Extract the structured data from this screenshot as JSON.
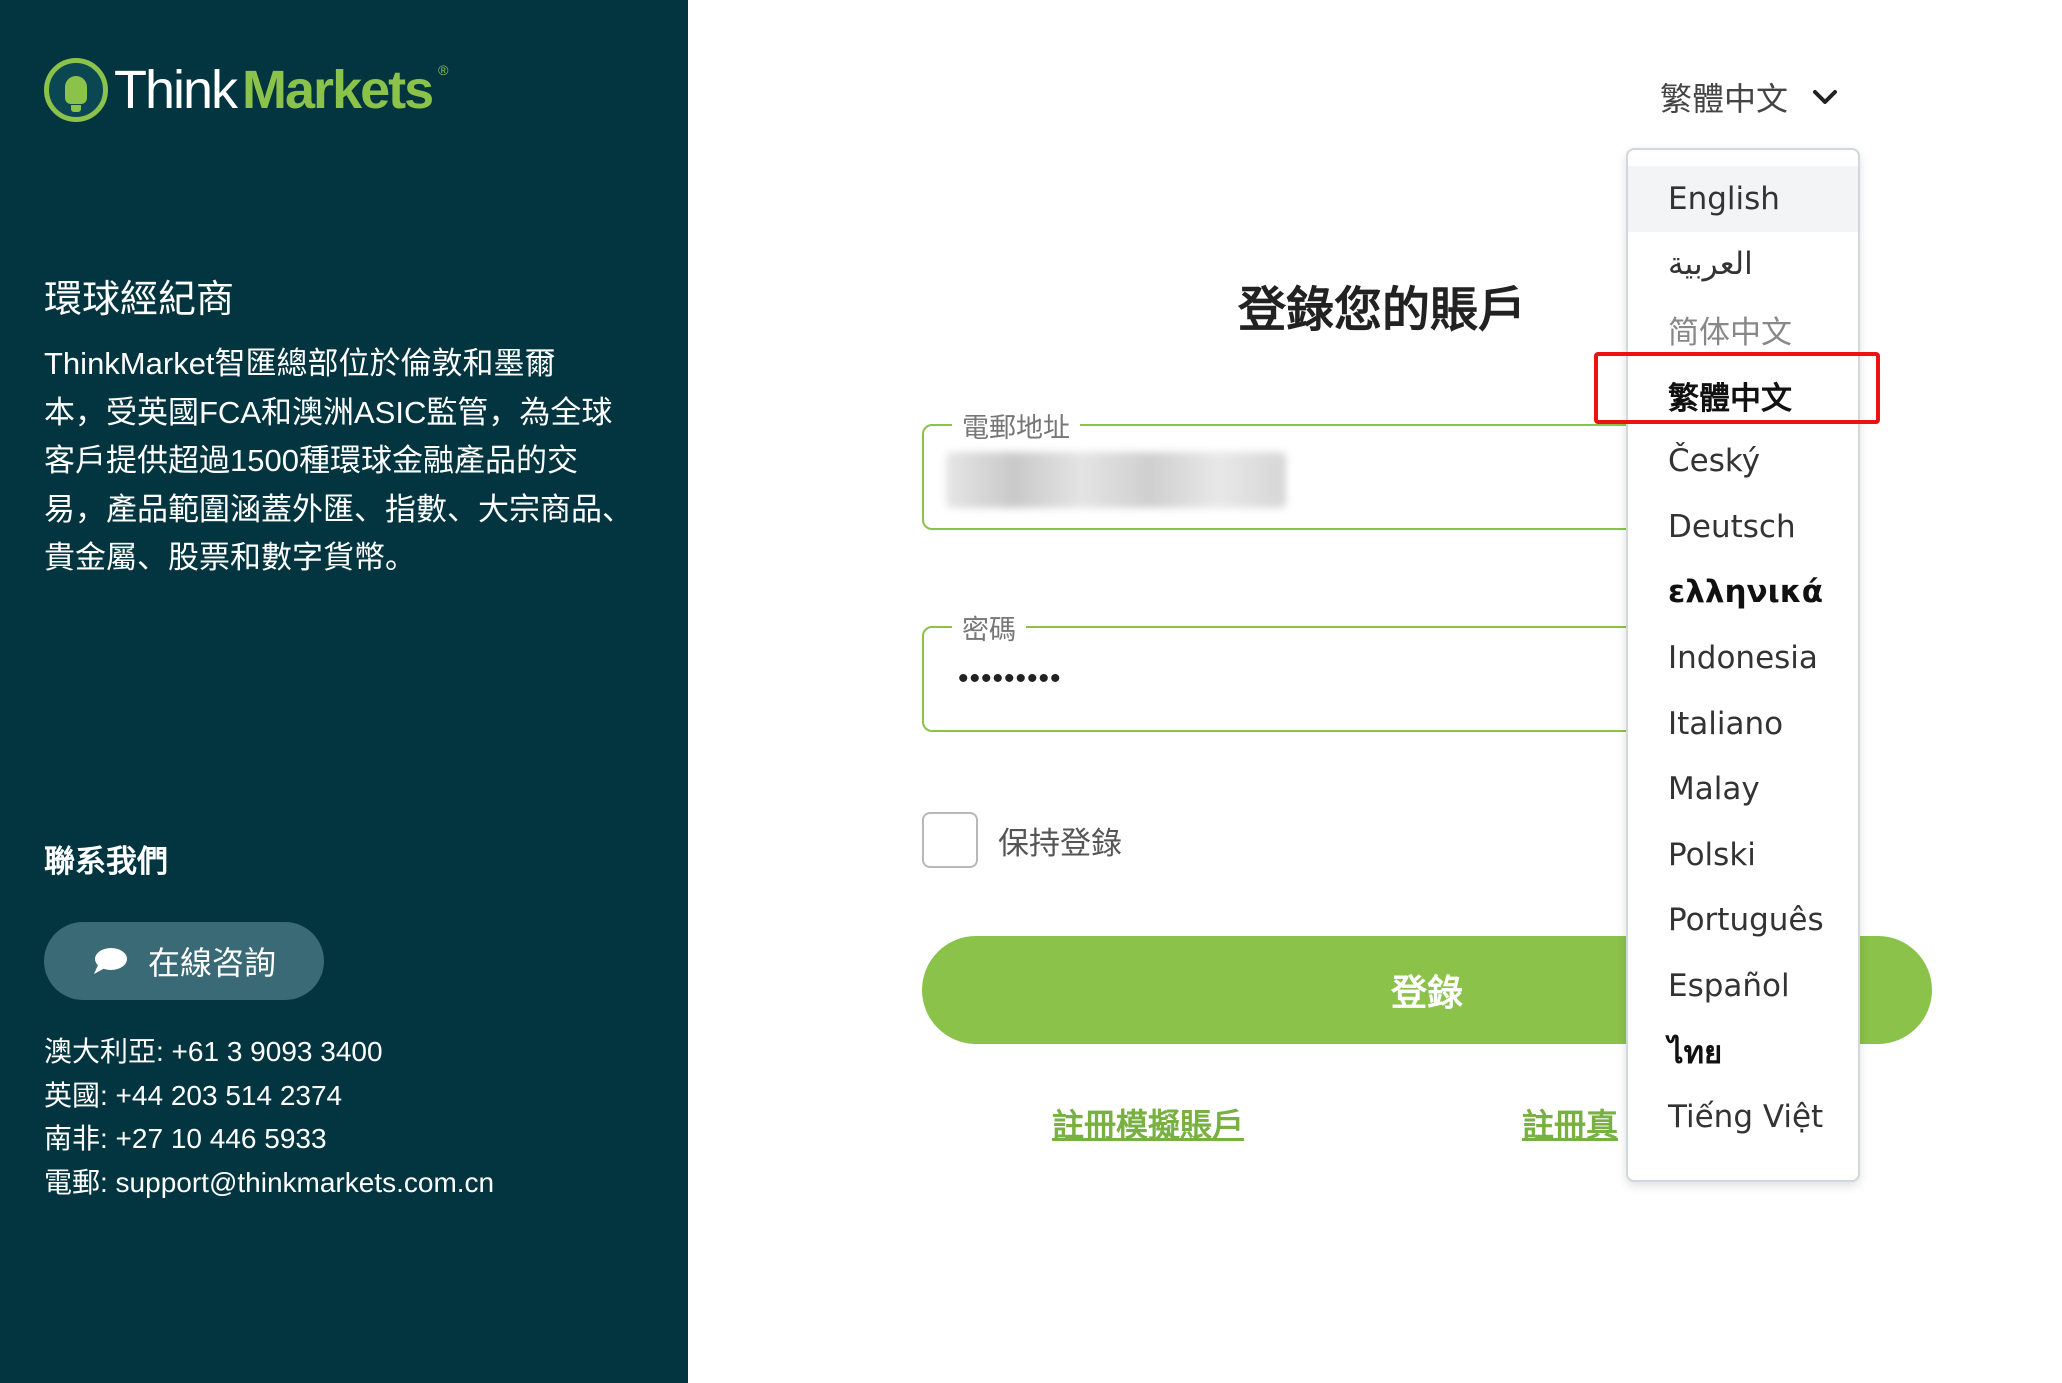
{
  "sidebar": {
    "logo": {
      "think": "Think",
      "markets": "Markets",
      "reg": "®"
    },
    "heading": "環球經紀商",
    "description_lines": [
      "ThinkMarket智匯總部位於倫敦和墨爾",
      "本，受英國FCA和澳洲ASIC監管，為全球",
      "客戶提供超過1500種環球金融產品的交",
      "易，產品範圍涵蓋外匯、指數、大宗商品、",
      "貴金屬、股票和數字貨幣。"
    ],
    "contact_title": "聯系我們",
    "chat_button": "在線咨詢",
    "contacts": [
      "澳大利亞: +61 3 9093 3400",
      "英國: +44 203 514 2374",
      "南非: +27 10 446 5933",
      "電郵: support@thinkmarkets.com.cn"
    ]
  },
  "header": {
    "language_selected": "繁體中文"
  },
  "form": {
    "title": "登錄您的賬戶",
    "email_label": "電郵地址",
    "password_label": "密碼",
    "password_mask": "•••••••••",
    "remember_label": "保持登錄",
    "login_button": "登錄",
    "link_demo": "註冊模擬賬戶",
    "link_real": "註冊真"
  },
  "language_menu": {
    "items": [
      {
        "label": "English"
      },
      {
        "label": "العربية"
      },
      {
        "label": "简体中文"
      },
      {
        "label": "繁體中文"
      },
      {
        "label": "Český"
      },
      {
        "label": "Deutsch"
      },
      {
        "label": "ελληνικά"
      },
      {
        "label": "Indonesia"
      },
      {
        "label": "Italiano"
      },
      {
        "label": "Malay"
      },
      {
        "label": "Polski"
      },
      {
        "label": "Português"
      },
      {
        "label": "Español"
      },
      {
        "label": "ไทย"
      },
      {
        "label": "Tiếng Việt"
      }
    ],
    "hover_index": 0,
    "selected_index": 3
  },
  "colors": {
    "sidebar_bg": "#033540",
    "brand_green": "#8bc24a",
    "highlight_red": "#e11"
  }
}
